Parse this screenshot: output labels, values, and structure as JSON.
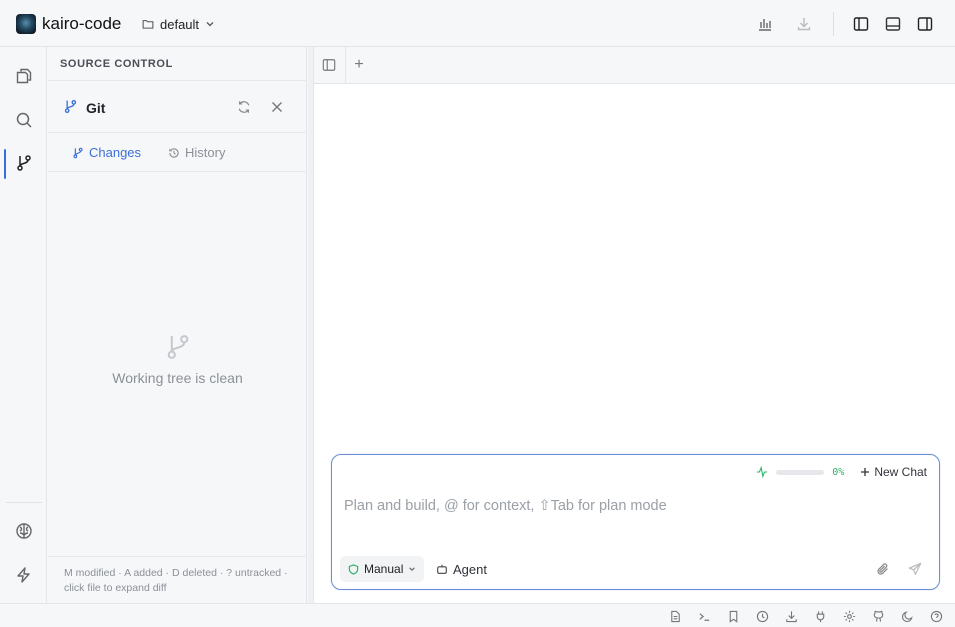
{
  "app": {
    "name": "kairo-code",
    "workspace": "default"
  },
  "topbar": {
    "icons": [
      "bar-chart-icon",
      "download-icon",
      "toggle-left-sidebar-icon",
      "toggle-bottom-panel-icon",
      "toggle-right-sidebar-icon"
    ]
  },
  "activity_bar": {
    "items": [
      "files-icon",
      "search-icon",
      "source-control-icon"
    ],
    "active": "source-control-icon",
    "bottom": [
      "brain-icon",
      "lightning-icon"
    ]
  },
  "source_control": {
    "title": "SOURCE CONTROL",
    "provider": "Git",
    "tabs": [
      {
        "label": "Changes",
        "active": true
      },
      {
        "label": "History",
        "active": false
      }
    ],
    "empty_message": "Working tree is clean",
    "legend": "M modified · A added · D deleted · ? untracked · click file to expand diff"
  },
  "editor": {
    "new_tab_label": "+"
  },
  "chat": {
    "context_percent": "0%",
    "context_fill": 0,
    "new_chat_label": "New Chat",
    "placeholder": "Plan and build, @ for context, ⇧Tab for plan mode",
    "input_value": "",
    "mode_label": "Manual",
    "agent_label": "Agent"
  },
  "status_bar": {
    "icons": [
      "file-icon",
      "terminal-icon",
      "bookmark-icon",
      "clock-icon",
      "download-icon",
      "plug-icon",
      "settings-icon",
      "github-icon",
      "moon-icon",
      "help-icon"
    ]
  },
  "colors": {
    "accent": "#3b6fd8",
    "success": "#2fb36a",
    "muted": "#8b9097"
  }
}
